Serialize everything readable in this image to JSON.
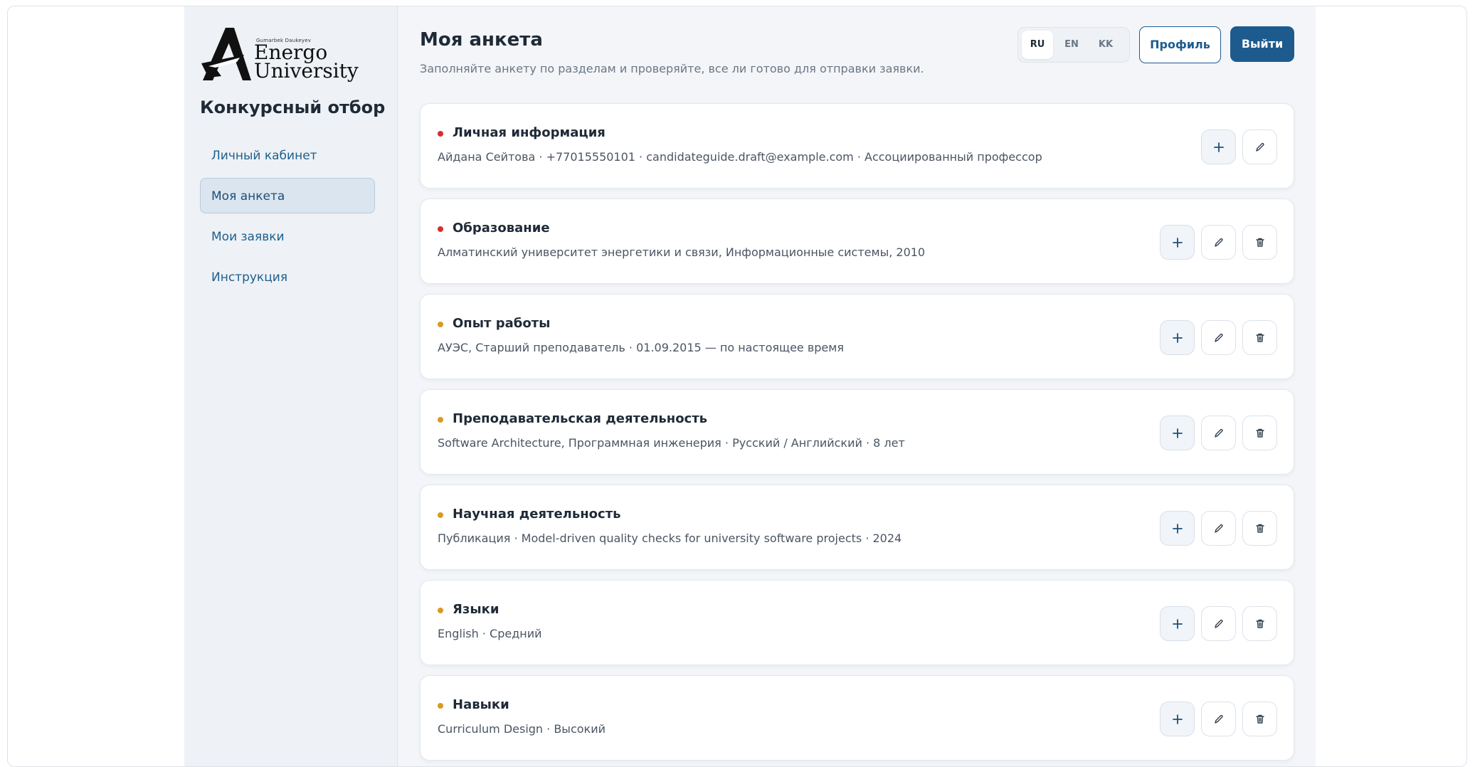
{
  "brand": {
    "small_text": "Gumarbek Daukeyev",
    "line1": "Energo",
    "line2": "University"
  },
  "sidebar": {
    "title": "Конкурсный отбор",
    "items": [
      {
        "label": "Личный кабинет",
        "active": false
      },
      {
        "label": "Моя анкета",
        "active": true
      },
      {
        "label": "Мои заявки",
        "active": false
      },
      {
        "label": "Инструкция",
        "active": false
      }
    ]
  },
  "header": {
    "title": "Моя анкета",
    "subtitle": "Заполняйте анкету по разделам и проверяйте, все ли готово для отправки заявки.",
    "languages": [
      "RU",
      "EN",
      "KK"
    ],
    "active_language": "RU",
    "profile_label": "Профиль",
    "logout_label": "Выйти"
  },
  "colors": {
    "accent": "#1d5b8e",
    "status_red": "#d92d2d",
    "status_amber": "#d99a1e"
  },
  "sections": [
    {
      "title": "Личная информация",
      "summary": "Айдана Сейтова · +77015550101 · candidateguide.draft@example.com · Ассоциированный профессор",
      "status": "red",
      "actions": [
        "add",
        "edit"
      ]
    },
    {
      "title": "Образование",
      "summary": "Алматинский университет энергетики и связи, Информационные системы, 2010",
      "status": "red",
      "actions": [
        "add",
        "edit",
        "delete"
      ]
    },
    {
      "title": "Опыт работы",
      "summary": "АУЭС, Старший преподаватель · 01.09.2015 — по настоящее время",
      "status": "amber",
      "actions": [
        "add",
        "edit",
        "delete"
      ]
    },
    {
      "title": "Преподавательская деятельность",
      "summary": "Software Architecture, Программная инженерия · Русский / Английский · 8 лет",
      "status": "amber",
      "actions": [
        "add",
        "edit",
        "delete"
      ]
    },
    {
      "title": "Научная деятельность",
      "summary": "Публикация · Model-driven quality checks for university software projects · 2024",
      "status": "amber",
      "actions": [
        "add",
        "edit",
        "delete"
      ]
    },
    {
      "title": "Языки",
      "summary": "English · Средний",
      "status": "amber",
      "actions": [
        "add",
        "edit",
        "delete"
      ]
    },
    {
      "title": "Навыки",
      "summary": "Curriculum Design · Высокий",
      "status": "amber",
      "actions": [
        "add",
        "edit",
        "delete"
      ]
    }
  ]
}
